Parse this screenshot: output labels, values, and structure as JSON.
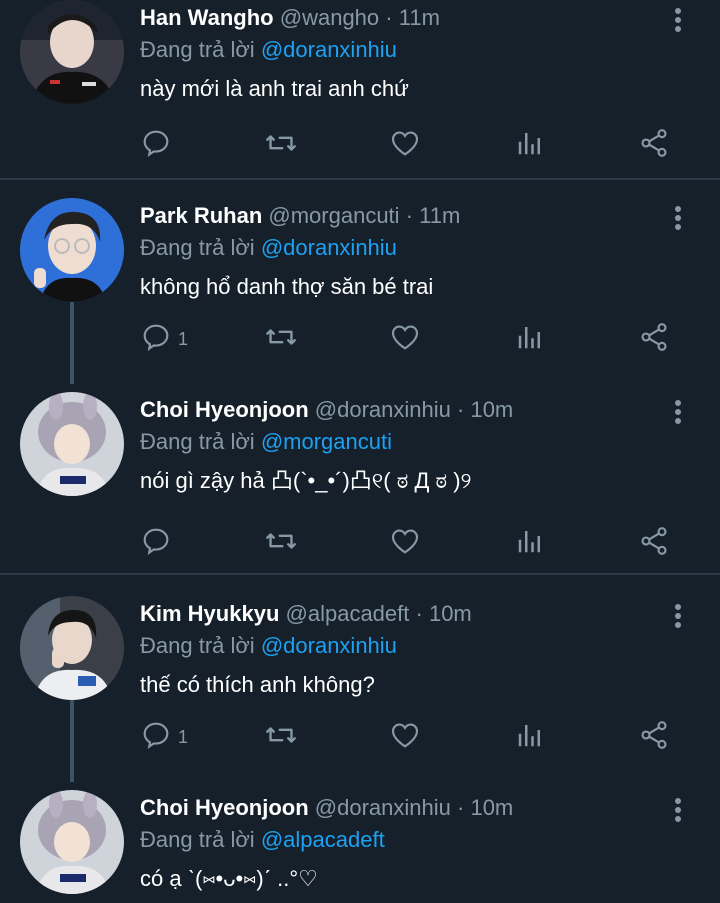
{
  "colors": {
    "background": "#15202b",
    "secondary_text": "#8899a6",
    "mention": "#1da1f2",
    "divider": "#2b3a47",
    "thread_line": "#3d5466"
  },
  "tweets": [
    {
      "name": "Han Wangho",
      "handle": "@wangho",
      "dot": "·",
      "time": "11m",
      "reply_prefix": "Đang trả lời",
      "reply_to": "@doranxinhiu",
      "text": "này mới là anh trai anh chứ",
      "reply_count": "",
      "avatar_icon": "avatar-han-wangho"
    },
    {
      "name": "Park Ruhan",
      "handle": "@morgancuti",
      "dot": "·",
      "time": "11m",
      "reply_prefix": "Đang trả lời",
      "reply_to": "@doranxinhiu",
      "text": "không hổ danh thợ săn bé trai",
      "reply_count": "1",
      "avatar_icon": "avatar-park-ruhan"
    },
    {
      "name": "Choi Hyeonjoon",
      "handle": "@doranxinhiu",
      "dot": "·",
      "time": "10m",
      "reply_prefix": "Đang trả lời",
      "reply_to": "@morgancuti",
      "text": "nói gì zậy hả 凸(`•_•´)凸୧( ಠ Д ಠ )୨",
      "reply_count": "",
      "avatar_icon": "avatar-choi-hyeonjoon"
    },
    {
      "name": "Kim Hyukkyu",
      "handle": "@alpacadeft",
      "dot": "·",
      "time": "10m",
      "reply_prefix": "Đang trả lời",
      "reply_to": "@doranxinhiu",
      "text": "thế có thích anh không?",
      "reply_count": "1",
      "avatar_icon": "avatar-kim-hyukkyu"
    },
    {
      "name": "Choi Hyeonjoon",
      "handle": "@doranxinhiu",
      "dot": "·",
      "time": "10m",
      "reply_prefix": "Đang trả lời",
      "reply_to": "@alpacadeft",
      "text": "có ạ ˋ(⑅•ᴗ•⑅)ˊ ..°♡",
      "reply_count": "",
      "avatar_icon": "avatar-choi-hyeonjoon"
    }
  ],
  "action_icons": [
    "reply-icon",
    "retweet-icon",
    "like-icon",
    "analytics-icon",
    "share-icon"
  ]
}
